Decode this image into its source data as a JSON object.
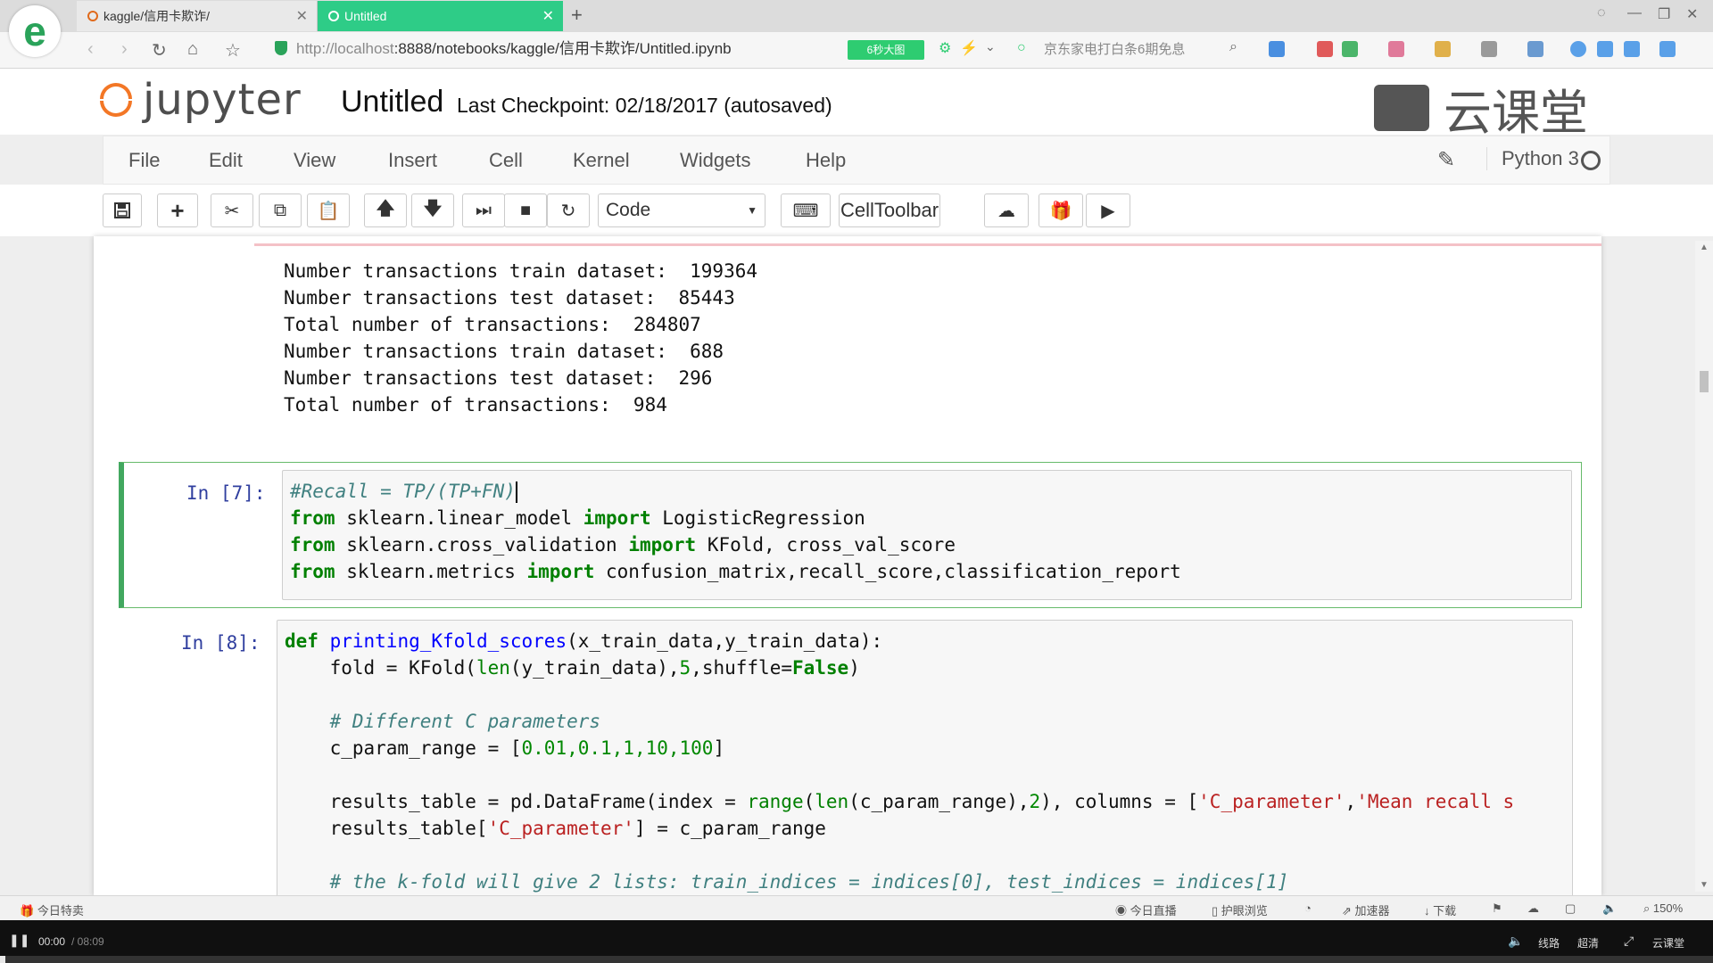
{
  "browser": {
    "tabs": [
      {
        "label": "kaggle/信用卡欺诈/",
        "active": false
      },
      {
        "label": "Untitled",
        "active": true
      }
    ],
    "new_tab": "+",
    "url_host": "http://localhost",
    "url_rest": ":8888/notebooks/kaggle/信用卡欺诈/Untitled.ipynb",
    "video_chip": "6秒大图",
    "search_hint": "京东家电打白条6期免息",
    "accent": "#2ecc87"
  },
  "jupyter": {
    "logo_text": "jupyter",
    "notebook_name": "Untitled",
    "checkpoint": "Last Checkpoint: 02/18/2017 (autosaved)",
    "watermark": "云课堂",
    "menu": [
      "File",
      "Edit",
      "View",
      "Insert",
      "Cell",
      "Kernel",
      "Widgets",
      "Help"
    ],
    "kernel": "Python 3",
    "cell_type": "Code",
    "celltoolbar": "CellToolbar",
    "toolbar_icons": [
      "save-icon",
      "plus-icon",
      "cut-icon",
      "copy-icon",
      "paste-icon",
      "arrow-up-icon",
      "arrow-down-icon",
      "step-forward-icon",
      "stop-icon",
      "restart-icon",
      "keyboard-icon",
      "cloud-upload-icon",
      "gift-icon",
      "youtube-icon"
    ]
  },
  "output": {
    "lines": [
      "Number transactions train dataset:  199364",
      "Number transactions test dataset:  85443",
      "Total number of transactions:  284807",
      "",
      "Number transactions train dataset:  688",
      "Number transactions test dataset:  296",
      "Total number of transactions:  984"
    ]
  },
  "cells": {
    "cell7": {
      "prompt": "In [7]:",
      "comment": "#Recall = TP/(TP+FN)",
      "l2_kw1": "from",
      "l2_mod": " sklearn.linear_model ",
      "l2_kw2": "import",
      "l2_rest": " LogisticRegression",
      "l3_kw1": "from",
      "l3_mod": " sklearn.cross_validation ",
      "l3_kw2": "import",
      "l3_rest": " KFold, cross_val_score",
      "l4_kw1": "from",
      "l4_mod": " sklearn.metrics ",
      "l4_kw2": "import",
      "l4_rest": " confusion_matrix,recall_score,classification_report"
    },
    "cell8": {
      "prompt": "In [8]:",
      "l1_kw": "def",
      "l1_fn": " printing_Kfold_scores",
      "l1_rest": "(x_train_data,y_train_data):",
      "l2_a": "    fold = KFold(",
      "l2_bi": "len",
      "l2_b": "(y_train_data),",
      "l2_num": "5",
      "l2_c": ",shuffle=",
      "l2_kw": "False",
      "l2_d": ")",
      "l3_cm": "    # Different C parameters",
      "l4_a": "    c_param_range = [",
      "l4_nums": "0.01,0.1,1,10,100",
      "l4_b": "]",
      "l5_a": "    results_table = pd.DataFrame(index = ",
      "l5_bi1": "range",
      "l5_b": "(",
      "l5_bi2": "len",
      "l5_c": "(c_param_range),",
      "l5_num": "2",
      "l5_d": "), columns = [",
      "l5_s1": "'C_parameter'",
      "l5_e": ",",
      "l5_s2": "'Mean recall s",
      "l6_a": "    results_table[",
      "l6_s": "'C_parameter'",
      "l6_b": "] = c_param_range",
      "l7_cm": "    # the k-fold will give 2 lists: train_indices = indices[0], test_indices = indices[1]"
    }
  },
  "statusbar": {
    "left": "今日特卖",
    "live": "今日直播",
    "screen": "护眼浏览",
    "accelerator": "加速器",
    "download": "下载",
    "zoom": "150%"
  },
  "player": {
    "time": "00:00",
    "duration": "/ 08:09",
    "progress": 0.003,
    "route": "线路",
    "quality": "超清",
    "brand": "云课堂"
  }
}
